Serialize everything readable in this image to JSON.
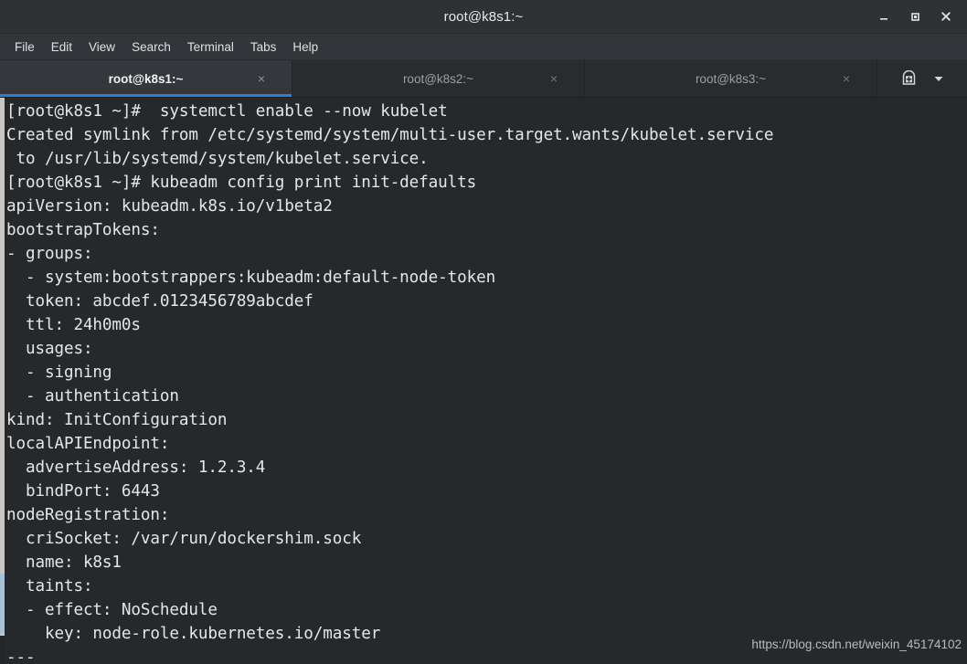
{
  "window": {
    "title": "root@k8s1:~",
    "controls": [
      {
        "name": "minimize",
        "glyph": "_"
      },
      {
        "name": "maximize",
        "glyph": "□"
      },
      {
        "name": "close",
        "glyph": "✕"
      }
    ]
  },
  "menubar": {
    "items": [
      "File",
      "Edit",
      "View",
      "Search",
      "Terminal",
      "Tabs",
      "Help"
    ]
  },
  "tabbar": {
    "tabs": [
      {
        "label": "root@k8s1:~",
        "active": true,
        "close": "×"
      },
      {
        "label": "root@k8s2:~",
        "active": false,
        "close": "×"
      },
      {
        "label": "root@k8s3:~",
        "active": false,
        "close": "×"
      }
    ],
    "new_tab_icon": "new-tab-icon",
    "tab_list_icon": "chevron-down-icon"
  },
  "terminal": {
    "prompt_user": "root",
    "prompt_host": "k8s1",
    "prompt_cwd": "~",
    "lines": [
      "[root@k8s1 ~]#  systemctl enable --now kubelet",
      "Created symlink from /etc/systemd/system/multi-user.target.wants/kubelet.service",
      " to /usr/lib/systemd/system/kubelet.service.",
      "[root@k8s1 ~]# kubeadm config print init-defaults",
      "apiVersion: kubeadm.k8s.io/v1beta2",
      "bootstrapTokens:",
      "- groups:",
      "  - system:bootstrappers:kubeadm:default-node-token",
      "  token: abcdef.0123456789abcdef",
      "  ttl: 24h0m0s",
      "  usages:",
      "  - signing",
      "  - authentication",
      "kind: InitConfiguration",
      "localAPIEndpoint:",
      "  advertiseAddress: 1.2.3.4",
      "  bindPort: 6443",
      "nodeRegistration:",
      "  criSocket: /var/run/dockershim.sock",
      "  name: k8s1",
      "  taints:",
      "  - effect: NoSchedule",
      "    key: node-role.kubernetes.io/master",
      "---"
    ]
  },
  "watermark": {
    "text": "https://blog.csdn.net/weixin_45174102"
  },
  "colors": {
    "titlebar_bg": "#2f3234",
    "menubar_bg": "#32363a",
    "tabbar_bg": "#292c2f",
    "active_tab_bg": "#34383c",
    "active_tab_accent": "#2a7fd4",
    "terminal_bg": "#26292c",
    "terminal_fg": "#e6e6e6",
    "scrollbar_trough": "#c9c6c1",
    "scrollbar_thumb": "#a8c2d4"
  }
}
